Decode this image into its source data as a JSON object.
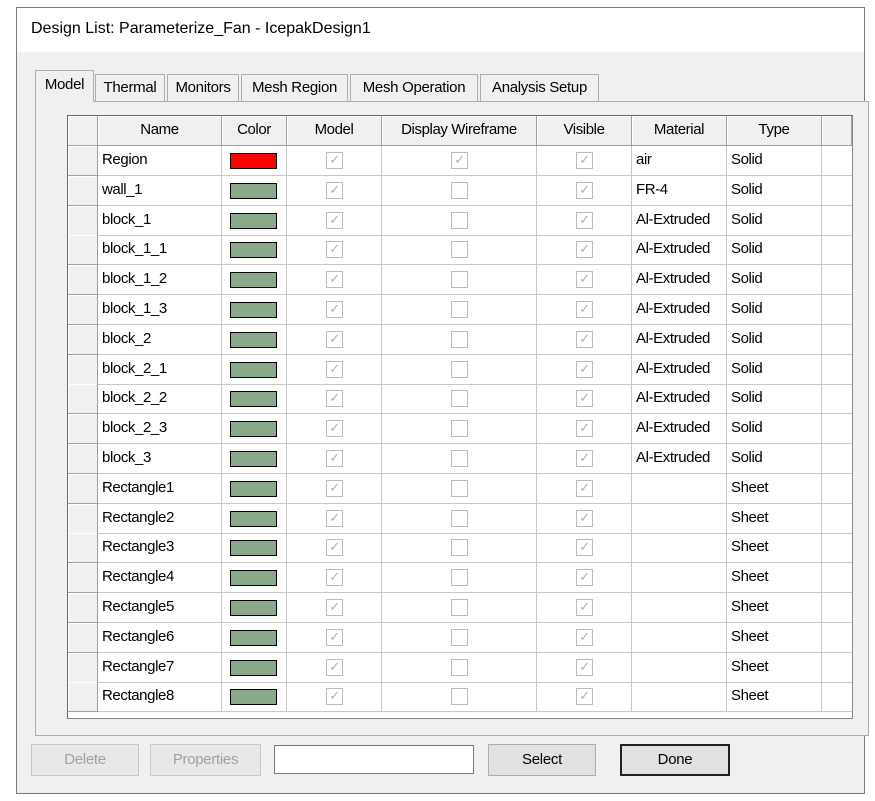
{
  "window": {
    "title": "Design List: Parameterize_Fan - IcepakDesign1"
  },
  "tabs": [
    {
      "label": "Model",
      "active": true
    },
    {
      "label": "Thermal",
      "active": false
    },
    {
      "label": "Monitors",
      "active": false
    },
    {
      "label": "Mesh Region",
      "active": false
    },
    {
      "label": "Mesh Operation",
      "active": false
    },
    {
      "label": "Analysis Setup",
      "active": false
    }
  ],
  "table": {
    "columns": [
      "Name",
      "Color",
      "Model",
      "Display Wireframe",
      "Visible",
      "Material",
      "Type"
    ],
    "rows": [
      {
        "name": "Region",
        "color": "#ff0000",
        "model": true,
        "wireframe": true,
        "visible": true,
        "material": "air",
        "type": "Solid"
      },
      {
        "name": "wall_1",
        "color": "#8aa88c",
        "model": true,
        "wireframe": false,
        "visible": true,
        "material": "FR-4",
        "type": "Solid"
      },
      {
        "name": "block_1",
        "color": "#8aa88c",
        "model": true,
        "wireframe": false,
        "visible": true,
        "material": "Al-Extruded",
        "type": "Solid"
      },
      {
        "name": "block_1_1",
        "color": "#8aa88c",
        "model": true,
        "wireframe": false,
        "visible": true,
        "material": "Al-Extruded",
        "type": "Solid"
      },
      {
        "name": "block_1_2",
        "color": "#8aa88c",
        "model": true,
        "wireframe": false,
        "visible": true,
        "material": "Al-Extruded",
        "type": "Solid"
      },
      {
        "name": "block_1_3",
        "color": "#8aa88c",
        "model": true,
        "wireframe": false,
        "visible": true,
        "material": "Al-Extruded",
        "type": "Solid"
      },
      {
        "name": "block_2",
        "color": "#8aa88c",
        "model": true,
        "wireframe": false,
        "visible": true,
        "material": "Al-Extruded",
        "type": "Solid"
      },
      {
        "name": "block_2_1",
        "color": "#8aa88c",
        "model": true,
        "wireframe": false,
        "visible": true,
        "material": "Al-Extruded",
        "type": "Solid"
      },
      {
        "name": "block_2_2",
        "color": "#8aa88c",
        "model": true,
        "wireframe": false,
        "visible": true,
        "material": "Al-Extruded",
        "type": "Solid"
      },
      {
        "name": "block_2_3",
        "color": "#8aa88c",
        "model": true,
        "wireframe": false,
        "visible": true,
        "material": "Al-Extruded",
        "type": "Solid"
      },
      {
        "name": "block_3",
        "color": "#8aa88c",
        "model": true,
        "wireframe": false,
        "visible": true,
        "material": "Al-Extruded",
        "type": "Solid"
      },
      {
        "name": "Rectangle1",
        "color": "#8aa88c",
        "model": true,
        "wireframe": false,
        "visible": true,
        "material": "",
        "type": "Sheet"
      },
      {
        "name": "Rectangle2",
        "color": "#8aa88c",
        "model": true,
        "wireframe": false,
        "visible": true,
        "material": "",
        "type": "Sheet"
      },
      {
        "name": "Rectangle3",
        "color": "#8aa88c",
        "model": true,
        "wireframe": false,
        "visible": true,
        "material": "",
        "type": "Sheet"
      },
      {
        "name": "Rectangle4",
        "color": "#8aa88c",
        "model": true,
        "wireframe": false,
        "visible": true,
        "material": "",
        "type": "Sheet"
      },
      {
        "name": "Rectangle5",
        "color": "#8aa88c",
        "model": true,
        "wireframe": false,
        "visible": true,
        "material": "",
        "type": "Sheet"
      },
      {
        "name": "Rectangle6",
        "color": "#8aa88c",
        "model": true,
        "wireframe": false,
        "visible": true,
        "material": "",
        "type": "Sheet"
      },
      {
        "name": "Rectangle7",
        "color": "#8aa88c",
        "model": true,
        "wireframe": false,
        "visible": true,
        "material": "",
        "type": "Sheet"
      },
      {
        "name": "Rectangle8",
        "color": "#8aa88c",
        "model": true,
        "wireframe": false,
        "visible": true,
        "material": "",
        "type": "Sheet"
      }
    ]
  },
  "buttons": {
    "delete": "Delete",
    "properties": "Properties",
    "select": "Select",
    "done": "Done"
  },
  "select_field": {
    "value": ""
  },
  "icons": {
    "checkbox_mark": "✓"
  }
}
